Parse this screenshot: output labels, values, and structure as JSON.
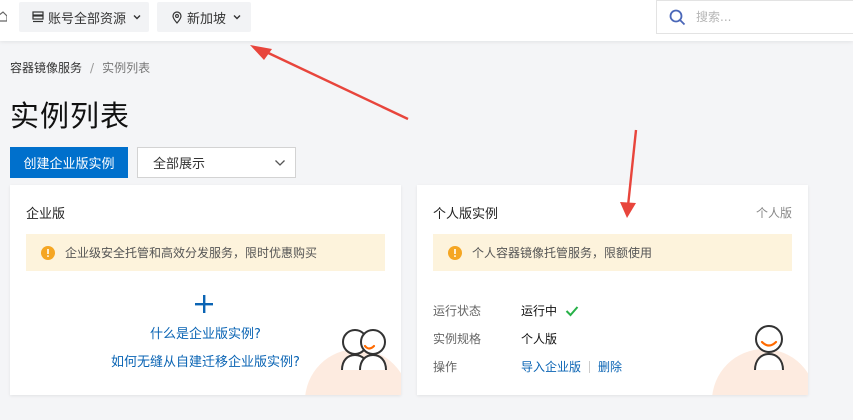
{
  "topbar": {
    "account_label": "账号全部资源",
    "region_label": "新加坡",
    "search_placeholder": "搜索..."
  },
  "breadcrumb": {
    "items": [
      "容器镜像服务",
      "实例列表"
    ],
    "separator": "/"
  },
  "page": {
    "title": "实例列表",
    "create_button": "创建企业版实例",
    "filter_value": "全部展示"
  },
  "enterprise_card": {
    "title": "企业版",
    "notice": "企业级安全托管和高效分发服务，限时优惠购买",
    "links": [
      "什么是企业版实例?",
      "如何无缝从自建迁移企业版实例?"
    ]
  },
  "personal_card": {
    "title": "个人版实例",
    "tag": "个人版",
    "notice": "个人容器镜像托管服务，限额使用",
    "rows": {
      "status_label": "运行状态",
      "status_value": "运行中",
      "spec_label": "实例规格",
      "spec_value": "个人版",
      "ops_label": "操作",
      "op_import": "导入企业版",
      "op_delete": "删除"
    }
  },
  "colors": {
    "primary": "#0070cc",
    "link": "#0a64b4",
    "notice_bg": "#fdf3dc",
    "warning": "#f5a623",
    "success": "#27b148",
    "annotation_arrow": "#e8453c"
  },
  "icons": [
    "layers-icon",
    "chevron-down-icon",
    "location-icon",
    "search-icon",
    "warning-icon",
    "plus-icon",
    "check-icon",
    "avatar-pair-icon",
    "avatar-icon"
  ]
}
